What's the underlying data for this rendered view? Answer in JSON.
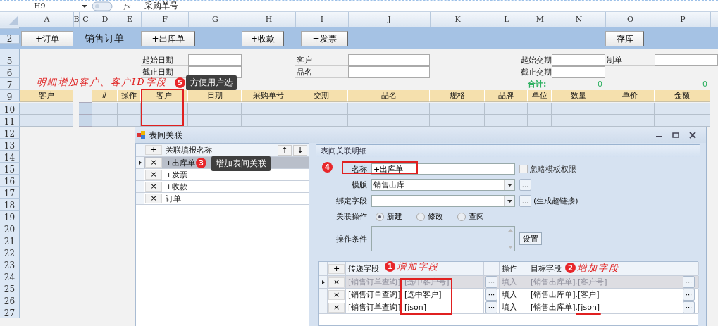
{
  "formula_bar": {
    "cell_ref": "H9",
    "fx": "fx",
    "formula": "采购单号"
  },
  "columns": [
    "A",
    "B",
    "C",
    "D",
    "E",
    "F",
    "G",
    "H",
    "I",
    "J",
    "K",
    "L",
    "M",
    "N",
    "O",
    "P"
  ],
  "row_numbers": [
    "2",
    "5",
    "6",
    "7",
    "9",
    "10",
    "11",
    "12",
    "13",
    "14",
    "15",
    "16",
    "17",
    "18",
    "19",
    "20",
    "21",
    "22",
    "23",
    "24",
    "25",
    "26",
    "27"
  ],
  "toolbar": [
    {
      "kind": "button",
      "label": "+订单"
    },
    {
      "kind": "title",
      "label": "销售订单"
    },
    {
      "kind": "button",
      "label": "+出库单"
    },
    {
      "kind": "button",
      "label": "+收款"
    },
    {
      "kind": "button",
      "label": "+发票"
    },
    {
      "kind": "button",
      "label": "存库"
    }
  ],
  "filters": [
    {
      "label": "起始日期"
    },
    {
      "label": "截止日期"
    },
    {
      "label": "客户"
    },
    {
      "label": "品名"
    },
    {
      "label": "起始交期"
    },
    {
      "label": "截止交期"
    },
    {
      "label": "制单"
    }
  ],
  "totals": {
    "label": "合计:",
    "quantity": "0",
    "amount": "0"
  },
  "detail_headers": [
    "客户",
    "#",
    "操作",
    "客户",
    "日期",
    "采购单号",
    "交期",
    "品名",
    "规格",
    "品牌",
    "单位",
    "数量",
    "单价",
    "金额"
  ],
  "sheet_note": "明细增加客户、客户ID字段",
  "dialog": {
    "title": "表间关联",
    "list": {
      "header": "关联填报名称",
      "add": "+",
      "delete": "×",
      "up": "↑",
      "down": "↓",
      "items": [
        {
          "label": "+出库单",
          "selected": true
        },
        {
          "label": "+发票",
          "selected": false
        },
        {
          "label": "+收款",
          "selected": false
        },
        {
          "label": "订单",
          "selected": false
        }
      ]
    },
    "detail": {
      "title": "表间关联明细",
      "name": {
        "label": "名称",
        "value": "+出库单"
      },
      "ignore_permission": {
        "label": "忽略模板权限",
        "checked": false
      },
      "template": {
        "label": "模版",
        "value": "销售出库",
        "browse": "..."
      },
      "bind_field": {
        "label": "绑定字段",
        "browse": "...",
        "hint": "(生成超链接)"
      },
      "operation": {
        "label": "关联操作",
        "options": [
          {
            "label": "新建",
            "selected": true
          },
          {
            "label": "修改",
            "selected": false
          },
          {
            "label": "查阅",
            "selected": false
          }
        ]
      },
      "condition": {
        "label": "操作条件",
        "button": "设置"
      },
      "fields": {
        "add": "+",
        "delete": "×",
        "browse": "···",
        "columns": [
          "传递字段",
          "操作",
          "目标字段"
        ],
        "rows": [
          {
            "source_table": "[销售订单查询]",
            "source_field": "[选中客户号]",
            "operation": "填入",
            "target": "[销售出库单].[客户号]",
            "disabled": true,
            "selected": true
          },
          {
            "source_table": "[销售订单查询]",
            "source_field": "[选中客户]",
            "operation": "填入",
            "target": "[销售出库单].[客户]",
            "disabled": false,
            "selected": false
          },
          {
            "source_table": "[销售订单查询]",
            "source_field": "[json]",
            "operation": "填入",
            "target": "[销售出库单].[json]",
            "disabled": false,
            "selected": false
          }
        ]
      }
    }
  },
  "annotations": [
    {
      "kind": "tooltip",
      "number": "5",
      "text": "方便用户选"
    },
    {
      "kind": "tooltip",
      "number": "3",
      "text": "增加表间关联"
    },
    {
      "kind": "badge",
      "number": "4"
    },
    {
      "kind": "note",
      "number": "1",
      "text": "增加字段"
    },
    {
      "kind": "note",
      "number": "2",
      "text": "增加字段"
    }
  ]
}
